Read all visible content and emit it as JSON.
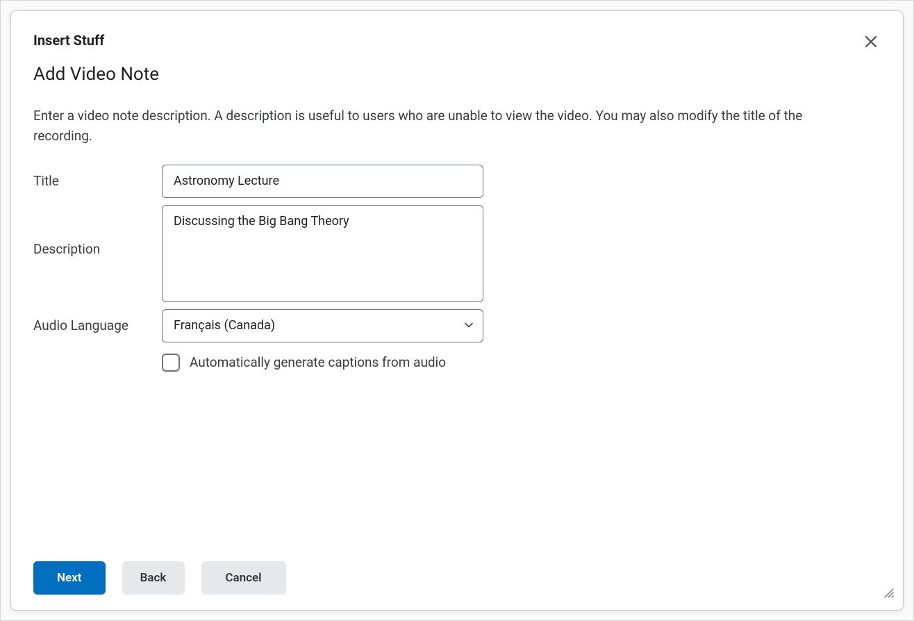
{
  "header": {
    "title": "Insert Stuff",
    "subtitle": "Add Video Note"
  },
  "instructions": "Enter a video note description. A description is useful to users who are unable to view the video. You may also modify the title of the recording.",
  "form": {
    "title_label": "Title",
    "title_value": "Astronomy Lecture",
    "description_label": "Description",
    "description_value": "Discussing the Big Bang Theory",
    "audio_language_label": "Audio Language",
    "audio_language_value": "Français (Canada)",
    "captions_checkbox_label": "Automatically generate captions from audio",
    "captions_checked": false
  },
  "buttons": {
    "next": "Next",
    "back": "Back",
    "cancel": "Cancel"
  }
}
